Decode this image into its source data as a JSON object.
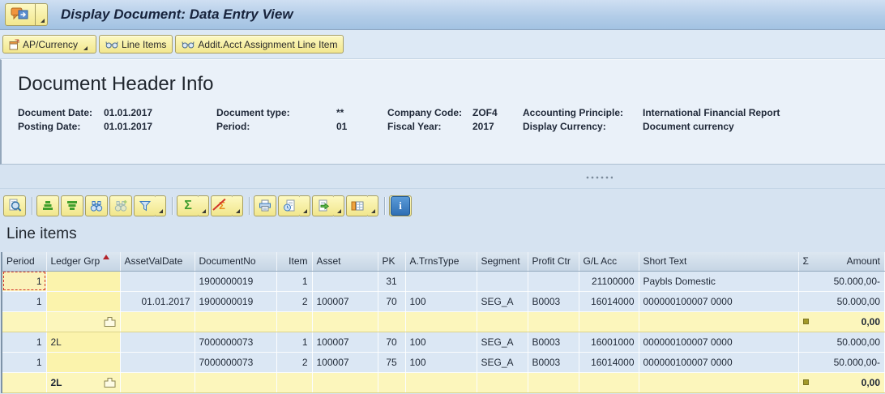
{
  "window": {
    "title": "Display Document: Data Entry View"
  },
  "app_toolbar": {
    "buttons": [
      {
        "label": "AP/Currency",
        "icon": "services-icon",
        "has_dropdown": true
      },
      {
        "label": "Line Items",
        "icon": "glasses-icon",
        "has_dropdown": false
      },
      {
        "label": "Addit.Acct Assignment Line Item",
        "icon": "glasses-icon",
        "has_dropdown": false
      }
    ]
  },
  "header_panel": {
    "title": "Document Header Info",
    "fields": {
      "document_date": {
        "label": "Document Date:",
        "value": "01.01.2017"
      },
      "posting_date": {
        "label": "Posting Date:",
        "value": "01.01.2017"
      },
      "document_type": {
        "label": "Document type:",
        "value": "**"
      },
      "period": {
        "label": "Period:",
        "value": "01"
      },
      "company_code": {
        "label": "Company Code:",
        "value": "ZOF4"
      },
      "fiscal_year": {
        "label": "Fiscal Year:",
        "value": "2017"
      },
      "accounting_principle": {
        "label": "Accounting Principle:",
        "value": "International Financial Report"
      },
      "display_currency": {
        "label": "Display Currency:",
        "value": "Document currency"
      }
    }
  },
  "grid_toolbar": {
    "sigma": "Σ",
    "info_glyph": "i",
    "icons": [
      "details",
      "sort-ascending",
      "sort-descending",
      "find",
      "find-next",
      "set-filter",
      "total",
      "subtotal",
      "print",
      "print-preview",
      "export",
      "choose-layout",
      "information"
    ]
  },
  "line_items": {
    "title": "Line items",
    "sigma": "Σ",
    "columns": [
      "Period",
      "Ledger Grp",
      "AssetValDate",
      "DocumentNo",
      "Item",
      "Asset",
      "PK",
      "A.TrnsType",
      "Segment",
      "Profit Ctr",
      "G/L Acc",
      "Short Text",
      "Amount"
    ],
    "rows": [
      {
        "period": "1",
        "ledger_grp": "",
        "asset_val_date": "",
        "document_no": "1900000019",
        "item": "1",
        "asset": "",
        "pk": "31",
        "a_trns_type": "",
        "segment": "",
        "profit_ctr": "",
        "gl_acc": "21100000",
        "short_text": "Paybls Domestic",
        "amount": "50.000,00-"
      },
      {
        "period": "1",
        "ledger_grp": "",
        "asset_val_date": "01.01.2017",
        "document_no": "1900000019",
        "item": "2",
        "asset": "100007",
        "pk": "70",
        "a_trns_type": "100",
        "segment": "SEG_A",
        "profit_ctr": "B0003",
        "gl_acc": "16014000",
        "short_text": "000000100007 0000",
        "amount": "50.000,00"
      },
      {
        "type": "subtotal",
        "ledger_grp": "",
        "amount": "0,00"
      },
      {
        "period": "1",
        "ledger_grp": "2L",
        "asset_val_date": "",
        "document_no": "7000000073",
        "item": "1",
        "asset": "100007",
        "pk": "70",
        "a_trns_type": "100",
        "segment": "SEG_A",
        "profit_ctr": "B0003",
        "gl_acc": "16001000",
        "short_text": "000000100007 0000",
        "amount": "50.000,00"
      },
      {
        "period": "1",
        "ledger_grp": "",
        "asset_val_date": "",
        "document_no": "7000000073",
        "item": "2",
        "asset": "100007",
        "pk": "75",
        "a_trns_type": "100",
        "segment": "SEG_A",
        "profit_ctr": "B0003",
        "gl_acc": "16014000",
        "short_text": "000000100007 0000",
        "amount": "50.000,00-"
      },
      {
        "type": "subtotal",
        "ledger_grp": "2L",
        "amount": "0,00"
      }
    ]
  }
}
